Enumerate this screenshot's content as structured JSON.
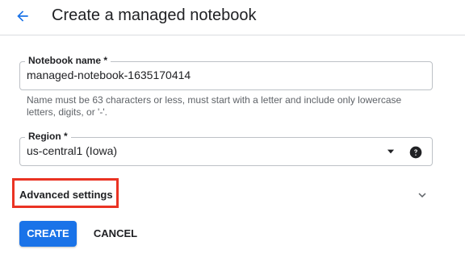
{
  "header": {
    "title": "Create a managed notebook",
    "back_icon": "arrow-back-icon"
  },
  "form": {
    "notebook_name": {
      "label": "Notebook name *",
      "value": "managed-notebook-1635170414",
      "hint": "Name must be 63 characters or less, must start with a letter and include only lowercase letters, digits, or '-'."
    },
    "region": {
      "label": "Region *",
      "value": "us-central1 (Iowa)",
      "dropdown_icon": "arrow-drop-down-icon",
      "help_icon": "help-icon"
    },
    "advanced": {
      "label": "Advanced settings",
      "icon": "chevron-down-icon",
      "highlight_color": "#ea3323"
    }
  },
  "actions": {
    "create_label": "CREATE",
    "cancel_label": "CANCEL",
    "primary_color": "#1a73e8"
  }
}
